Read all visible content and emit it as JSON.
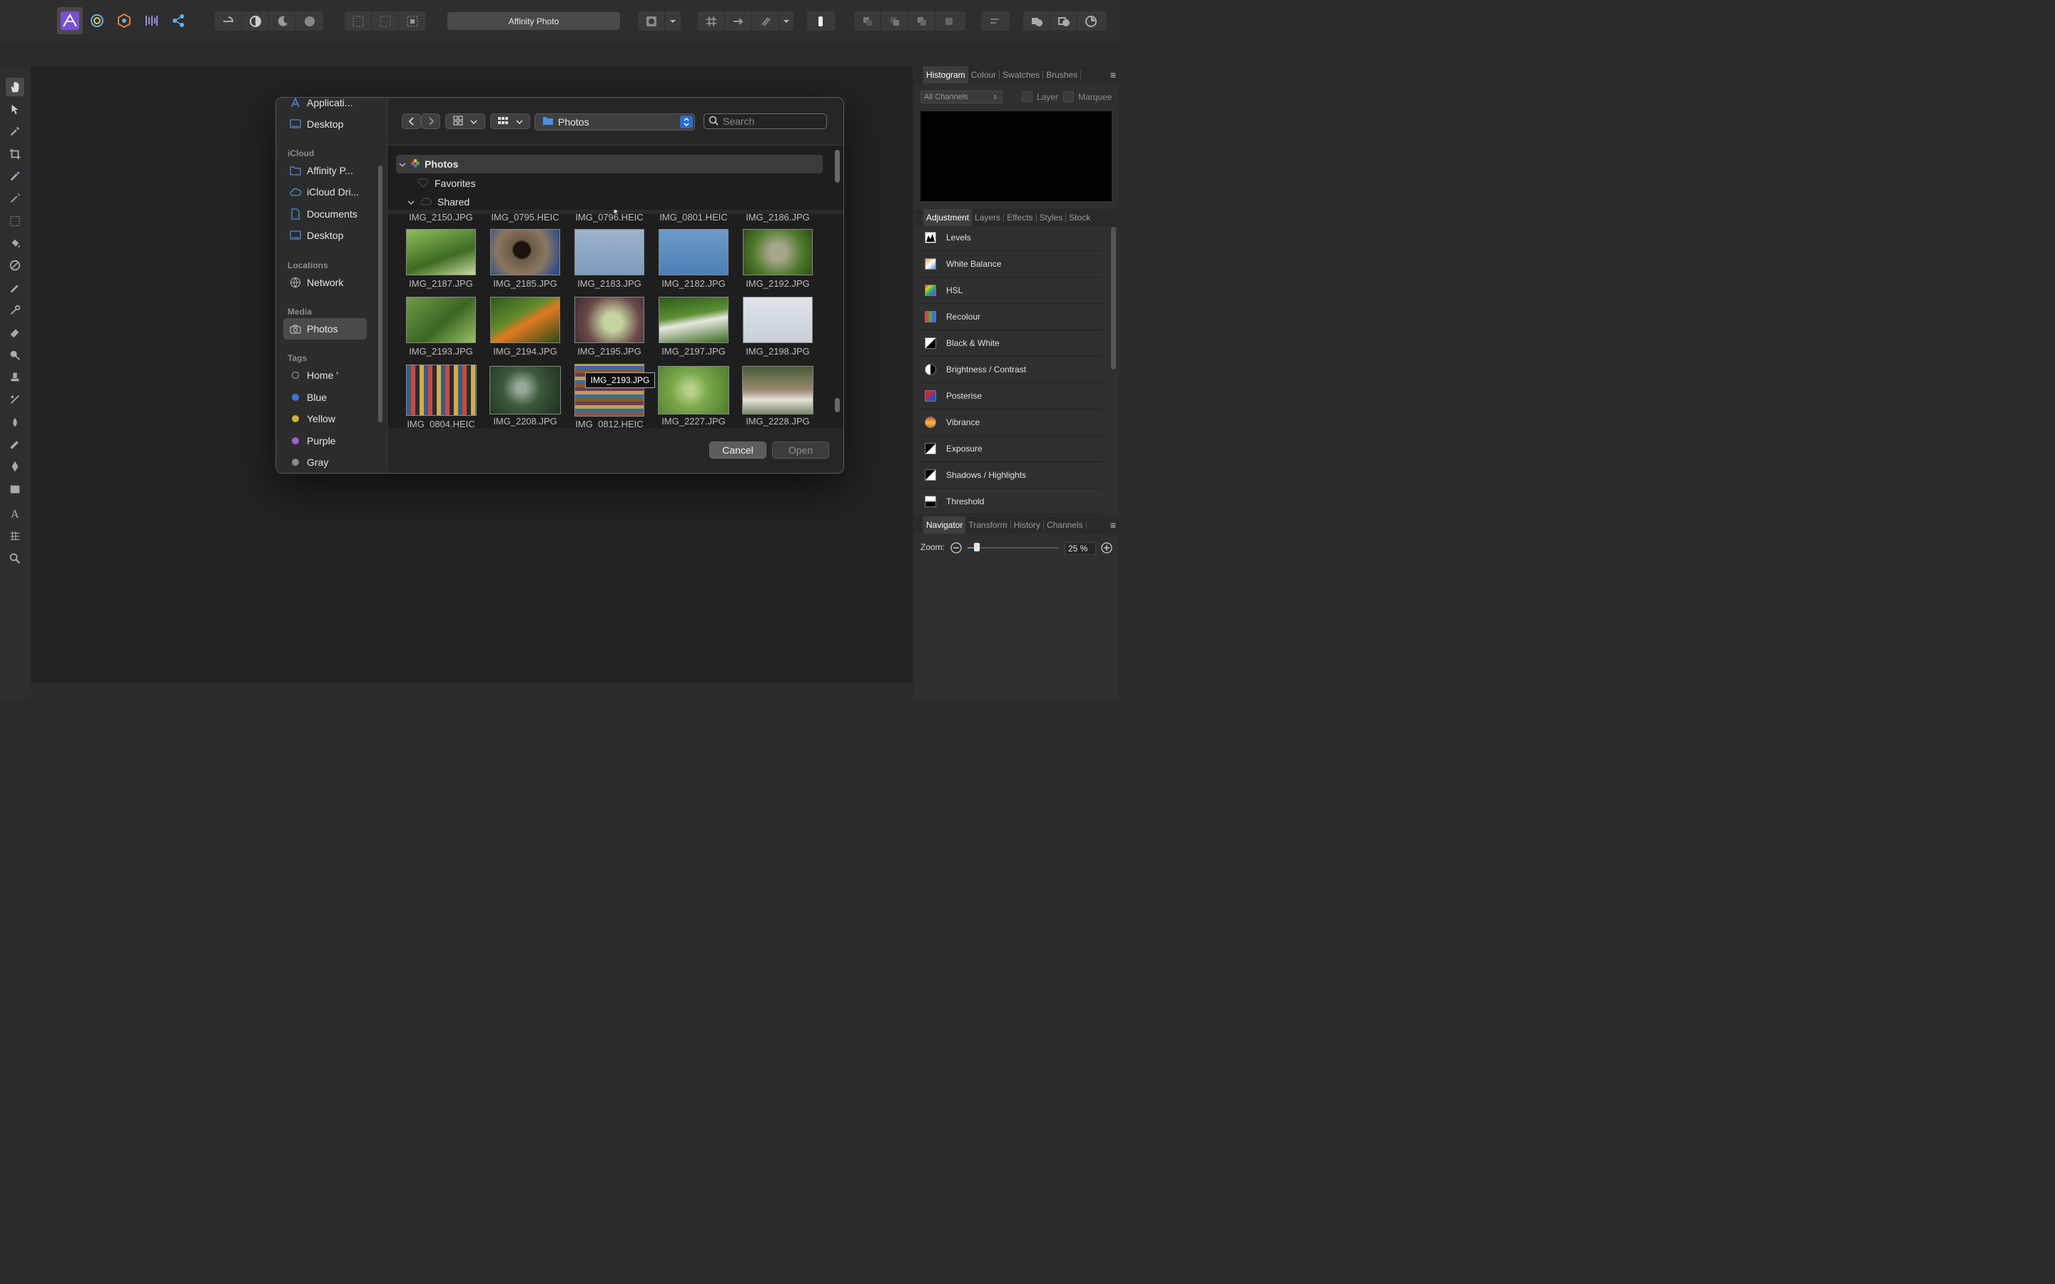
{
  "app": {
    "title": "Affinity Photo"
  },
  "panels": {
    "top_tabs": [
      "Histogram",
      "Colour",
      "Swatches",
      "Brushes"
    ],
    "histogram": {
      "channel": "All Channels",
      "layer_label": "Layer",
      "marquee_label": "Marquee"
    },
    "mid_tabs": [
      "Adjustment",
      "Layers",
      "Effects",
      "Styles",
      "Stock"
    ],
    "adjustments": [
      "Levels",
      "White Balance",
      "HSL",
      "Recolour",
      "Black & White",
      "Brightness / Contrast",
      "Posterise",
      "Vibrance",
      "Exposure",
      "Shadows / Highlights",
      "Threshold"
    ],
    "bottom_tabs": [
      "Navigator",
      "Transform",
      "History",
      "Channels"
    ],
    "navigator": {
      "zoom_label": "Zoom:",
      "zoom_value": "25 %"
    }
  },
  "dialog": {
    "sidebar": {
      "top_items": [
        "Applicati...",
        "Desktop"
      ],
      "icloud_header": "iCloud",
      "icloud_items": [
        "Affinity P...",
        "iCloud Dri...",
        "Documents",
        "Desktop"
      ],
      "locations_header": "Locations",
      "locations_items": [
        "Network"
      ],
      "media_header": "Media",
      "media_items": [
        "Photos"
      ],
      "tags_header": "Tags",
      "tags": [
        {
          "label": "Home '",
          "color": "none"
        },
        {
          "label": "Blue",
          "color": "#3b76d6"
        },
        {
          "label": "Yellow",
          "color": "#d4b23a"
        },
        {
          "label": "Purple",
          "color": "#a45ec7"
        },
        {
          "label": "Gray",
          "color": "#8a8a8a"
        }
      ]
    },
    "location": "Photos",
    "search_placeholder": "Search",
    "tree": [
      "Photos",
      "Favorites",
      "Shared"
    ],
    "partial_captions": [
      "IMG_2150.JPG",
      "IMG_0795.HEIC",
      "IMG_0796.HEIC",
      "IMG_0801.HEIC",
      "IMG_2186.JPG"
    ],
    "grid": [
      [
        "IMG_2187.JPG",
        "IMG_2185.JPG",
        "IMG_2183.JPG",
        "IMG_2182.JPG",
        "IMG_2192.JPG"
      ],
      [
        "IMG_2193.JPG",
        "IMG_2194.JPG",
        "IMG_2195.JPG",
        "IMG_2197.JPG",
        "IMG_2198.JPG"
      ],
      [
        "IMG_0804.HEIC",
        "IMG_2208.JPG",
        "IMG_0812.HEIC",
        "IMG_2227.JPG",
        "IMG_2228.JPG"
      ]
    ],
    "tooltip": "IMG_2193.JPG",
    "cancel_label": "Cancel",
    "open_label": "Open"
  }
}
